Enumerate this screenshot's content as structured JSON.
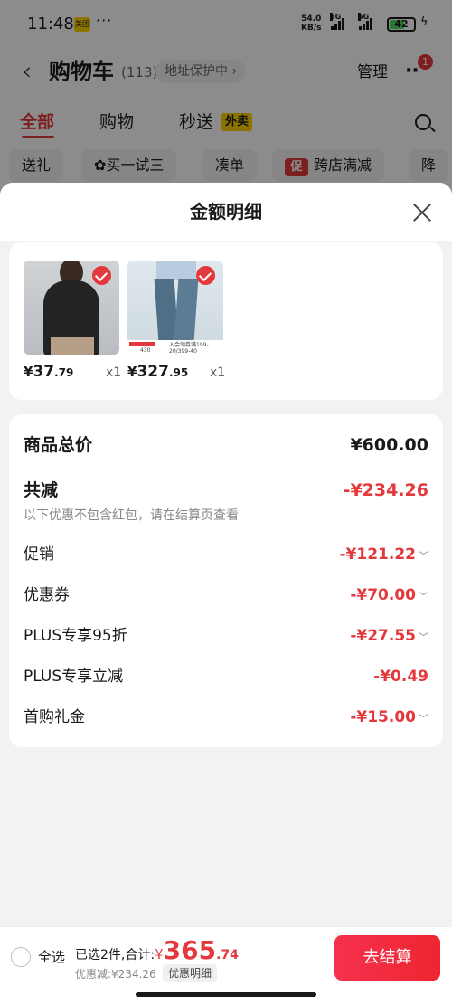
{
  "status_bar": {
    "time": "11:48",
    "app_badge": "美团",
    "more_dots": "···",
    "net_speed": "54.0",
    "net_unit": "KB/s",
    "signal1_label": "5G",
    "signal2_label": "5G",
    "battery": "42"
  },
  "header": {
    "back_icon": "chevron-left-icon",
    "title": "购物车",
    "count": "(113)",
    "address_protect": "地址保护中 ›",
    "manage": "管理",
    "more_icon": "more-dots-icon",
    "badge": "1"
  },
  "tabs": [
    {
      "label": "全部",
      "active": true
    },
    {
      "label": "购物",
      "active": false
    },
    {
      "label": "秒送",
      "active": false
    }
  ],
  "tab_tag": "外卖",
  "chips": [
    "送礼",
    "买一试三",
    "凑单",
    "跨店满减",
    "降"
  ],
  "chip_promo_tag": "促",
  "sheet": {
    "title": "金额明细",
    "close_icon": "close-icon",
    "products": [
      {
        "name": "black-sweater",
        "price_symbol": "¥",
        "price_int": "37",
        "price_dec": ".79",
        "qty": "x1"
      },
      {
        "name": "jeans",
        "price_symbol": "¥",
        "price_int": "327",
        "price_dec": ".95",
        "qty": "x1",
        "strip_price": "430",
        "strip_text": "入会领券满199-20/399-40"
      }
    ],
    "summary": {
      "total_label": "商品总价",
      "total_value": "¥600.00",
      "reduce_label": "共减",
      "reduce_value": "-¥234.26",
      "note": "以下优惠不包含红包，请在结算页查看",
      "items": [
        {
          "label": "促销",
          "value": "-¥121.22",
          "expandable": true
        },
        {
          "label": "优惠券",
          "value": "-¥70.00",
          "expandable": true
        },
        {
          "label": "PLUS专享95折",
          "value": "-¥27.55",
          "expandable": true
        },
        {
          "label": "PLUS专享立减",
          "value": "-¥0.49",
          "expandable": false
        },
        {
          "label": "首购礼金",
          "value": "-¥15.00",
          "expandable": true
        }
      ]
    }
  },
  "bottom_bar": {
    "select_all": "全选",
    "selected_text": "已选2件,合计:",
    "total_symbol": "¥",
    "total_int": "365",
    "total_dec": ".74",
    "discount": "优惠减:¥234.26",
    "detail_tag": "优惠明细",
    "checkout": "去结算"
  },
  "colors": {
    "accent": "#e4393c",
    "tab_tag_bg": "#ffd100"
  }
}
